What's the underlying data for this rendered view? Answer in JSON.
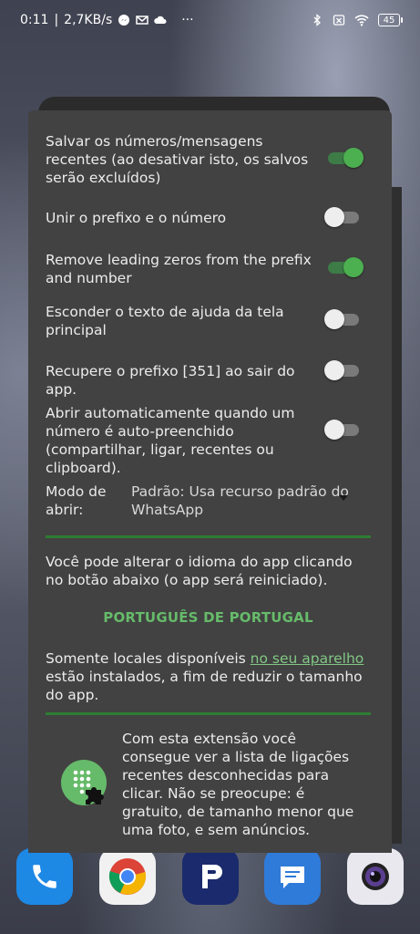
{
  "status_bar": {
    "time": "0:11",
    "speed": "2,7KB/s",
    "overflow": "···",
    "battery": "45",
    "icons": [
      "messenger-icon",
      "gmail-icon",
      "cloud-icon",
      "bluetooth-icon",
      "no-sim-icon",
      "wifi-icon",
      "battery-icon"
    ]
  },
  "settings": [
    {
      "label": "Salvar os números/mensagens recentes (ao desativar isto, os salvos serão excluídos)",
      "enabled": true
    },
    {
      "label": "Unir o prefixo e o número",
      "enabled": false
    },
    {
      "label": "Remove leading zeros from the prefix and number",
      "enabled": true
    },
    {
      "label": "Esconder o texto de ajuda da tela principal",
      "enabled": false
    },
    {
      "label": "Recupere o prefixo [351] ao sair do app.",
      "enabled": false
    },
    {
      "label": "Abrir automaticamente quando um número é auto-preenchido (compartilhar, ligar, recentes ou clipboard).",
      "enabled": false
    }
  ],
  "open_mode": {
    "label": "Modo de abrir:",
    "value": "Padrão: Usa recurso padrão do WhatsApp"
  },
  "language": {
    "info": "Você pode alterar o idioma do app clicando no botão abaixo (o app será reiniciado).",
    "button": "PORTUGUÊS DE PORTUGAL",
    "locales_before": "Somente locales disponíveis ",
    "locales_link": "no seu aparelho",
    "locales_after": " estão instalados, a fim de reduzir o tamanho do app."
  },
  "extension": {
    "text": "Com esta extensão você consegue ver a lista de ligações recentes desconhecidas para clicar. Não se preocupe: é gratuito, de tamanho menor que uma foto, e sem anúncios."
  },
  "dock": [
    "phone-app-icon",
    "chrome-app-icon",
    "pdf-app-icon",
    "messages-app-icon",
    "camera-app-icon"
  ],
  "colors": {
    "accent": "#4caf50",
    "divider": "#2e7d32",
    "dialog_bg": "#424242",
    "link": "#81c784"
  }
}
